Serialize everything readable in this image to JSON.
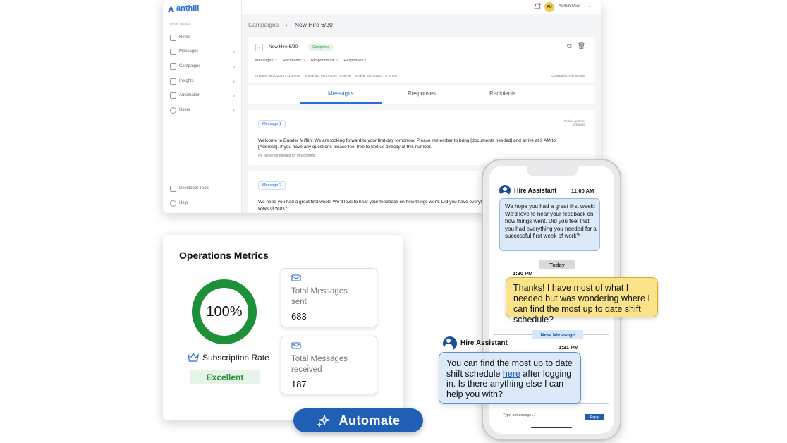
{
  "app": {
    "logo": "anthill",
    "main_menu_label": "MAIN MENU",
    "sidebar": [
      {
        "label": "Home",
        "icon": "home-icon"
      },
      {
        "label": "Messages",
        "icon": "chat-icon"
      },
      {
        "label": "Campaigns",
        "icon": "campaign-icon"
      },
      {
        "label": "Insights",
        "icon": "chart-icon"
      },
      {
        "label": "Automation",
        "icon": "automation-icon"
      },
      {
        "label": "Users",
        "icon": "user-icon"
      }
    ],
    "sidebar_bottom": [
      {
        "label": "Developer Tools",
        "icon": "sliders-icon"
      },
      {
        "label": "Help",
        "icon": "help-icon"
      }
    ],
    "user": {
      "initials": "AU",
      "name": "Admin User"
    },
    "breadcrumb": {
      "parent": "Campaigns",
      "current": "New Hire 6/20"
    },
    "campaign": {
      "name": "New Hire 6/20",
      "status": "Completed",
      "messages": "Messages: 7",
      "recipients": "Recipients: 2",
      "respondents": "Respondents: 0",
      "responses": "Responses: 0",
      "created": "Created: 06/20/2024 / 11:30 AM",
      "scheduled": "Scheduled: 06/27/2024 / 8:56 PM",
      "ended": "Ended: 06/27/2024 / 9:15 PM",
      "created_by": "Created by: Admin User"
    },
    "tabs": [
      "Messages",
      "Responses",
      "Recipients"
    ],
    "messages": [
      {
        "tag": "Message 1",
        "text": "Welcome to Dunder Mifflin! We are looking forward to your first day tomorrow. Please remember to bring [documents needed] and arrive at 9 AM to [Address]. If you have any questions please feel free to text us directly at this number.",
        "note": "No response needed for this content.",
        "follow_label": "Follow up timer",
        "follow_value": "1 Minute"
      },
      {
        "tag": "Message 2",
        "text": "We hope you had a great first week! We'd love to hear your feedback on how things went. Did you have everything you needed for a successful first week of work?"
      }
    ]
  },
  "metrics": {
    "title": "Operations Metrics",
    "donut_value": "100%",
    "donut_fraction": 1.0,
    "subscription_label": "Subscription Rate",
    "subscription_status": "Excellent",
    "sent_label": "Total Messages sent",
    "sent_value": "683",
    "received_label": "Total Messages received",
    "received_value": "187",
    "automate": "Automate"
  },
  "phone": {
    "sender": "Hire Assistant",
    "time1": "11:00 AM",
    "msg1": "We hope you had a great first week! We'd love to hear your feedback on how things went. Did you feel that you had everything you needed for a successful first week of work?",
    "today": "Today",
    "time2": "1:30 PM",
    "reply_text": "Thanks! I have most of what I needed but was wondering where I can find the most up to date shift schedule?",
    "new_message": "New Message",
    "time3": "1:31 PM",
    "answer_before": "You can find the most up to date shift schedule ",
    "answer_link": "here",
    "answer_after": " after logging in. Is there anything else I can help you with?",
    "input_placeholder": "Type a message...",
    "reply_button": "Reply"
  },
  "colors": {
    "brand": "#2a6fd1",
    "green": "#1e8f3a",
    "automate": "#1f5fb5",
    "yellow": "#fbe38a"
  }
}
